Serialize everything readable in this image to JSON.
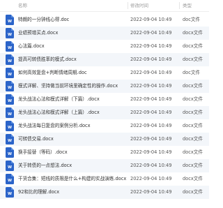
{
  "header": {
    "name": "名称",
    "date": "修改时间",
    "type": "类型"
  },
  "files": [
    {
      "name": "特朗的一分钟线心得.doc",
      "date": "2022-09-04 10:49",
      "type": "doc文件"
    },
    {
      "name": "业绩预增买点.docx",
      "date": "2022-09-04 10:49",
      "type": "docx文件"
    },
    {
      "name": "心法篇.docx",
      "date": "2022-09-04 10:49",
      "type": "docx文件"
    },
    {
      "name": "提高可转债胜率的模式.docx",
      "date": "2022-09-04 10:49",
      "type": "docx文件"
    },
    {
      "name": "如何高效复盘+判断情绪周期.doc",
      "date": "2022-09-04 10:49",
      "type": "doc文件"
    },
    {
      "name": "模式详解、坚持做当前环境里确定性的操作.docx",
      "date": "2022-09-04 10:49",
      "type": "docx文件"
    },
    {
      "name": "龙头战法心法和模式详解（下篇）.docx",
      "date": "2022-09-04 10:49",
      "type": "docx文件"
    },
    {
      "name": "龙头战法心法和模式详解（上篇）.docx",
      "date": "2022-09-04 10:49",
      "type": "docx文件"
    },
    {
      "name": "龙头战法每日复盘的案例分析.docx",
      "date": "2022-09-04 10:49",
      "type": "docx文件"
    },
    {
      "name": "可转债交易.docx",
      "date": "2022-09-04 10:49",
      "type": "docx文件"
    },
    {
      "name": "换手接替（等码）.docx",
      "date": "2022-09-04 10:49",
      "type": "docx文件"
    },
    {
      "name": "关于转债的一点想法.docx",
      "date": "2022-09-04 10:49",
      "type": "docx文件"
    },
    {
      "name": "干货合集：短线的质限是什么+构建的实战演练.docx",
      "date": "2022-09-04 10:49",
      "type": "docx文件"
    },
    {
      "name": "92和比的理解.docx",
      "date": "2022-09-04 10:49",
      "type": "docx文件"
    }
  ]
}
